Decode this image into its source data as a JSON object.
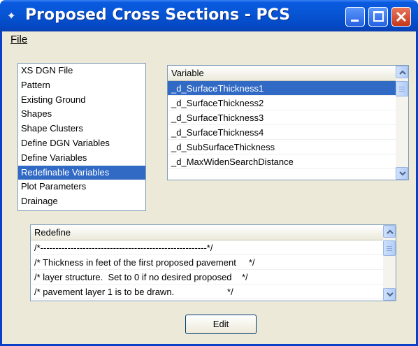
{
  "window": {
    "title": "Proposed Cross Sections - PCS",
    "icon": "app-icon"
  },
  "menubar": {
    "file_label": "File"
  },
  "categories": [
    {
      "label": "XS DGN File"
    },
    {
      "label": "Pattern"
    },
    {
      "label": "Existing Ground"
    },
    {
      "label": "Shapes"
    },
    {
      "label": "Shape Clusters"
    },
    {
      "label": "Define DGN Variables"
    },
    {
      "label": "Define Variables"
    },
    {
      "label": "Redefinable Variables"
    },
    {
      "label": "Plot Parameters"
    },
    {
      "label": "Drainage"
    }
  ],
  "selected_category": "Redefinable Variables",
  "variable_grid": {
    "header": "Variable",
    "rows": [
      "_d_SurfaceThickness1",
      "_d_SurfaceThickness2",
      "_d_SurfaceThickness3",
      "_d_SurfaceThickness4",
      "_d_SubSurfaceThickness",
      "_d_MaxWidenSearchDistance"
    ],
    "selected": "_d_SurfaceThickness1"
  },
  "redefine_grid": {
    "header": "Redefine",
    "rows": [
      "/*-------------------------------------------------------*/",
      "/* Thickness in feet of the first proposed pavement     */",
      "/* layer structure.  Set to 0 if no desired proposed    */",
      "/* pavement layer 1 is to be drawn.                     */"
    ]
  },
  "buttons": {
    "edit_label": "Edit"
  },
  "colors": {
    "selection": "#316ac5",
    "titlebar": "#0756d6",
    "window_bg": "#ece9d8"
  }
}
